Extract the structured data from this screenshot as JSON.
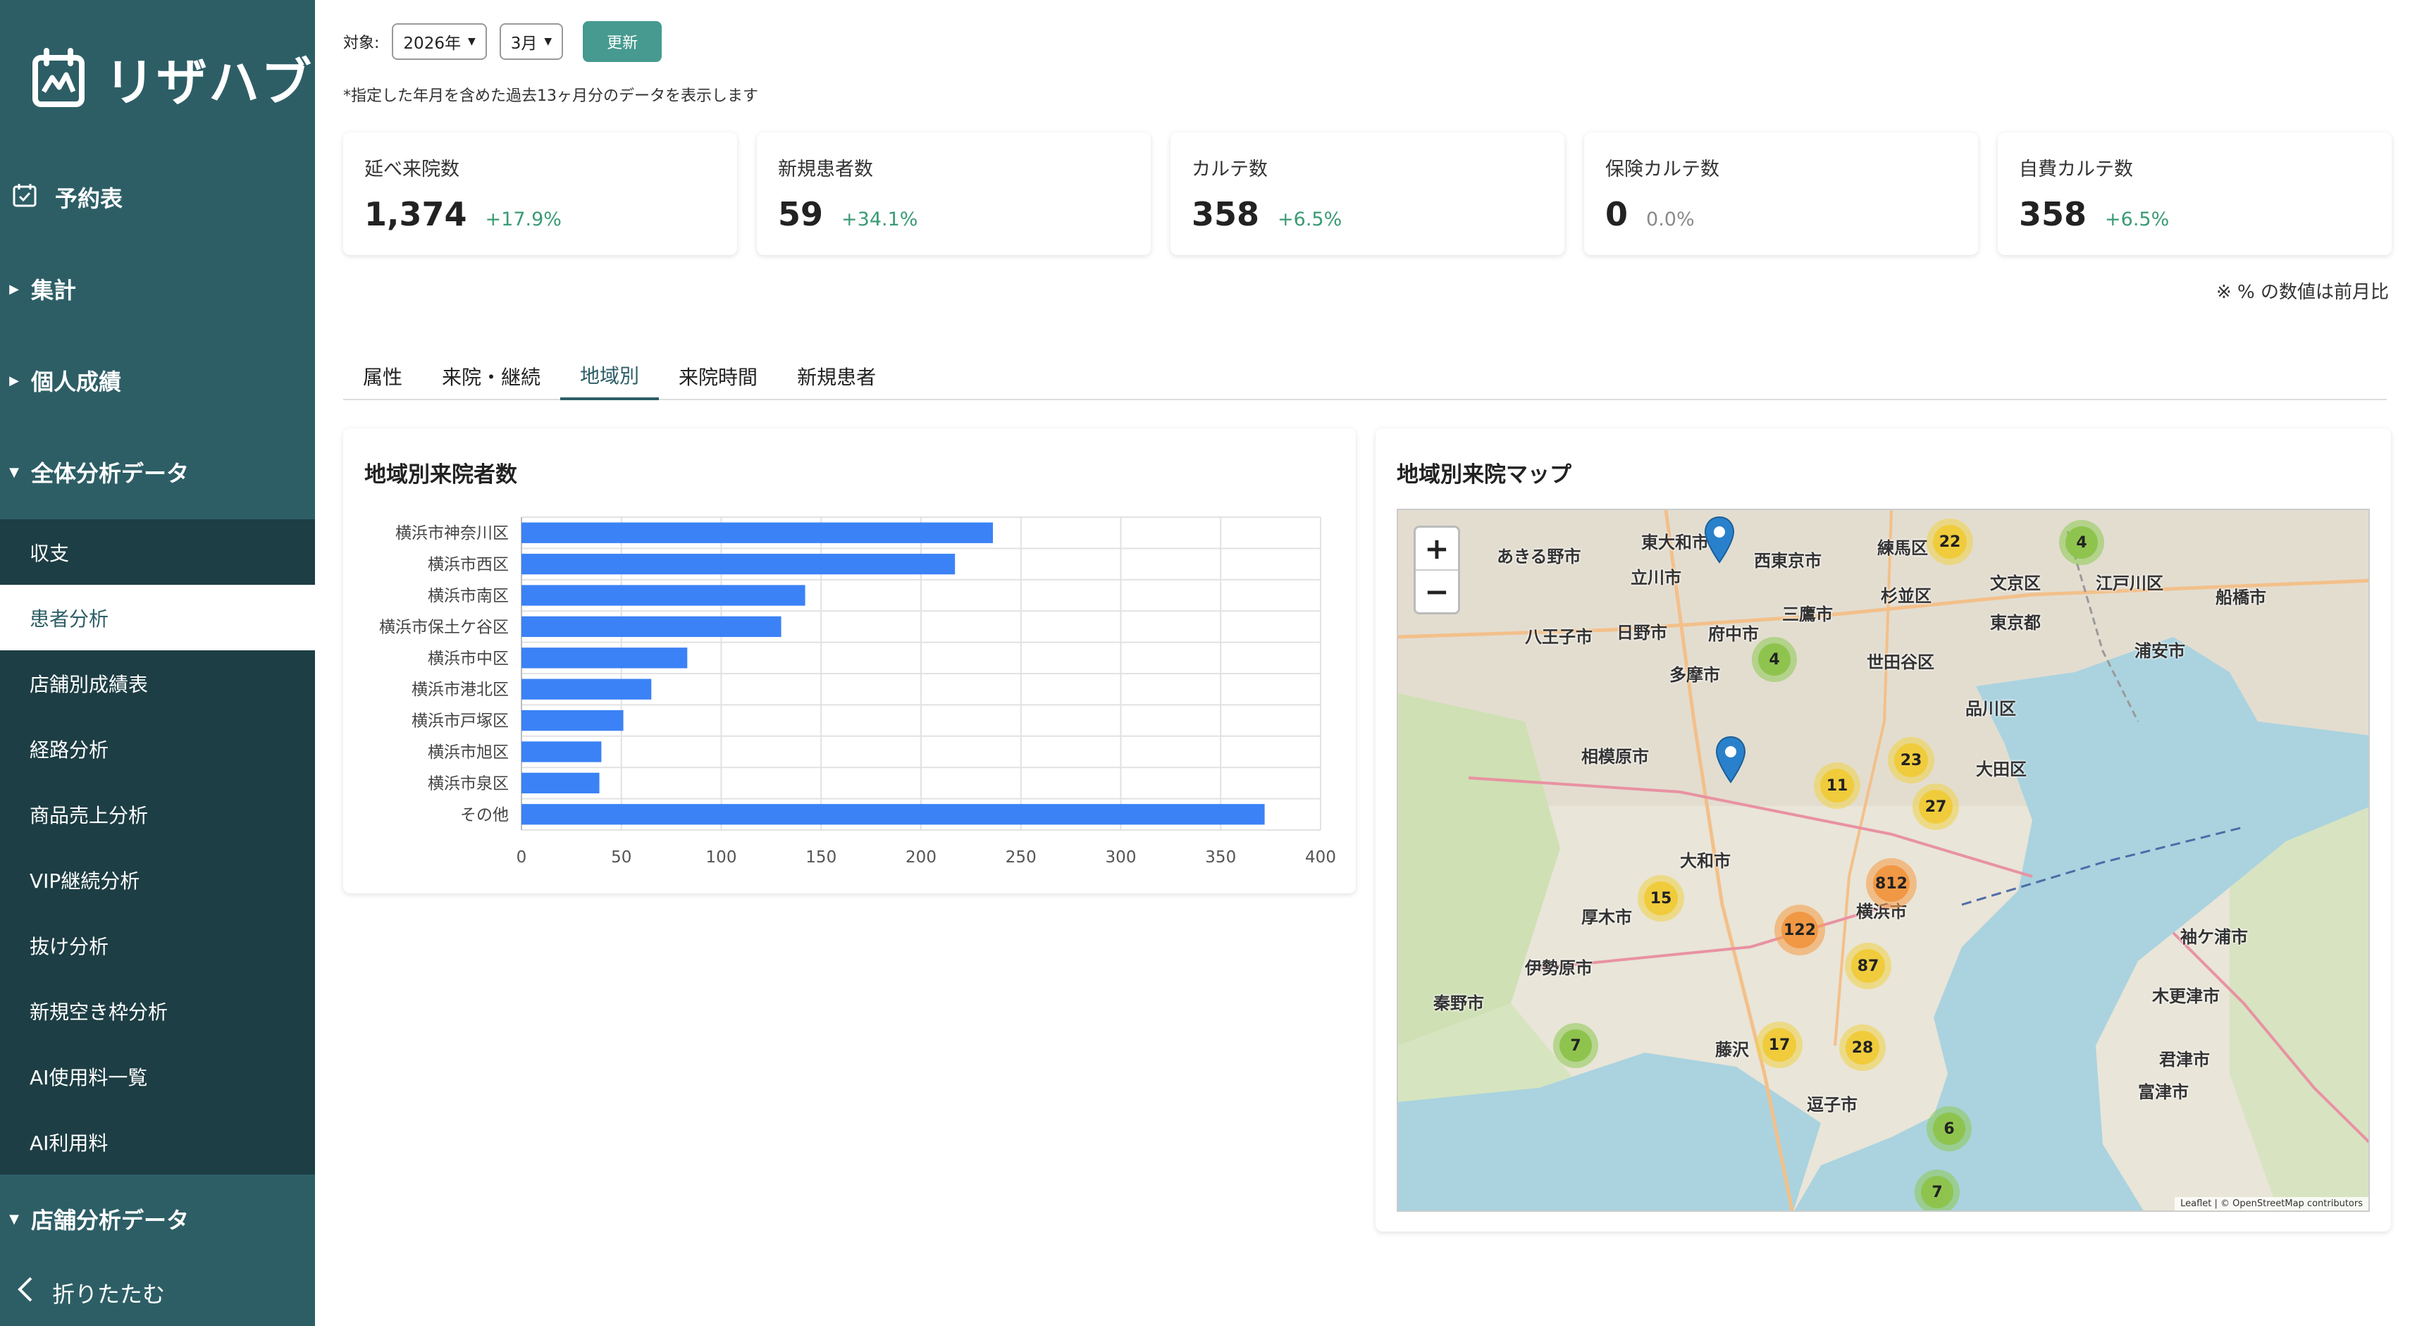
{
  "app": {
    "name": "リザハブ"
  },
  "sidebar": {
    "reservation": "予約表",
    "aggregate": "集計",
    "personal": "個人成績",
    "overall": "全体分析データ",
    "sub_items": [
      "収支",
      "患者分析",
      "店舗別成績表",
      "経路分析",
      "商品売上分析",
      "VIP継続分析",
      "抜け分析",
      "新規空き枠分析",
      "AI使用料一覧",
      "AI利用料"
    ],
    "active_sub": "患者分析",
    "store": "店舗分析データ",
    "collapse": "折りたたむ"
  },
  "filter": {
    "label": "対象:",
    "year": "2026年",
    "month": "3月",
    "update": "更新",
    "note": "*指定した年月を含めた過去13ヶ月分のデータを表示します"
  },
  "kpis": [
    {
      "label": "延べ来院数",
      "value": "1,374",
      "change": "+17.9%"
    },
    {
      "label": "新規患者数",
      "value": "59",
      "change": "+34.1%"
    },
    {
      "label": "カルテ数",
      "value": "358",
      "change": "+6.5%"
    },
    {
      "label": "保険カルテ数",
      "value": "0",
      "change": "0.0%"
    },
    {
      "label": "自費カルテ数",
      "value": "358",
      "change": "+6.5%"
    }
  ],
  "compare_note": "※ % の数値は前月比",
  "tabs": [
    "属性",
    "来院・継続",
    "地域別",
    "来院時間",
    "新規患者"
  ],
  "active_tab": "地域別",
  "bar_card": {
    "title": "地域別来院者数"
  },
  "map_card": {
    "title": "地域別来院マップ",
    "zoom_in": "+",
    "zoom_out": "−",
    "attribution": "Leaflet | © OpenStreetMap contributors",
    "places": [
      "東大和市",
      "あきる野市",
      "立川市",
      "西東京市",
      "練馬区",
      "文京区",
      "江戸川区",
      "船橋市",
      "八王子市",
      "日野市",
      "府中市",
      "三鷹市",
      "杉並区",
      "東京都",
      "浦安市",
      "多摩市",
      "世田谷区",
      "品川区",
      "相模原市",
      "大田区",
      "大和市",
      "厚木市",
      "横浜市",
      "伊勢原市",
      "秦野市",
      "藤沢",
      "逗子市",
      "袖ケ浦市",
      "木更津市",
      "君津市",
      "富津市"
    ],
    "clusters": [
      {
        "label": "22",
        "level": "y"
      },
      {
        "label": "4",
        "level": "g"
      },
      {
        "label": "4",
        "level": "g"
      },
      {
        "label": "23",
        "level": "y"
      },
      {
        "label": "11",
        "level": "y"
      },
      {
        "label": "27",
        "level": "y"
      },
      {
        "label": "812",
        "level": "o"
      },
      {
        "label": "15",
        "level": "y"
      },
      {
        "label": "122",
        "level": "o"
      },
      {
        "label": "87",
        "level": "y"
      },
      {
        "label": "7",
        "level": "g"
      },
      {
        "label": "17",
        "level": "y"
      },
      {
        "label": "28",
        "level": "y"
      },
      {
        "label": "6",
        "level": "g"
      },
      {
        "label": "7",
        "level": "g"
      }
    ]
  },
  "chart_data": {
    "type": "bar",
    "orientation": "horizontal",
    "title": "地域別来院者数",
    "categories": [
      "横浜市神奈川区",
      "横浜市西区",
      "横浜市南区",
      "横浜市保土ケ谷区",
      "横浜市中区",
      "横浜市港北区",
      "横浜市戸塚区",
      "横浜市旭区",
      "横浜市泉区",
      "その他"
    ],
    "values": [
      236,
      217,
      142,
      130,
      83,
      65,
      51,
      40,
      39,
      372
    ],
    "xlim": [
      0,
      400
    ],
    "xticks": [
      0,
      50,
      100,
      150,
      200,
      250,
      300,
      350,
      400
    ],
    "grid": true,
    "color": "#3b82f6"
  },
  "colors": {
    "sidebar": "#2d5e66",
    "sidebar_sub": "#1d3e44",
    "accent": "#469a8f",
    "positive": "#3a9b74"
  }
}
